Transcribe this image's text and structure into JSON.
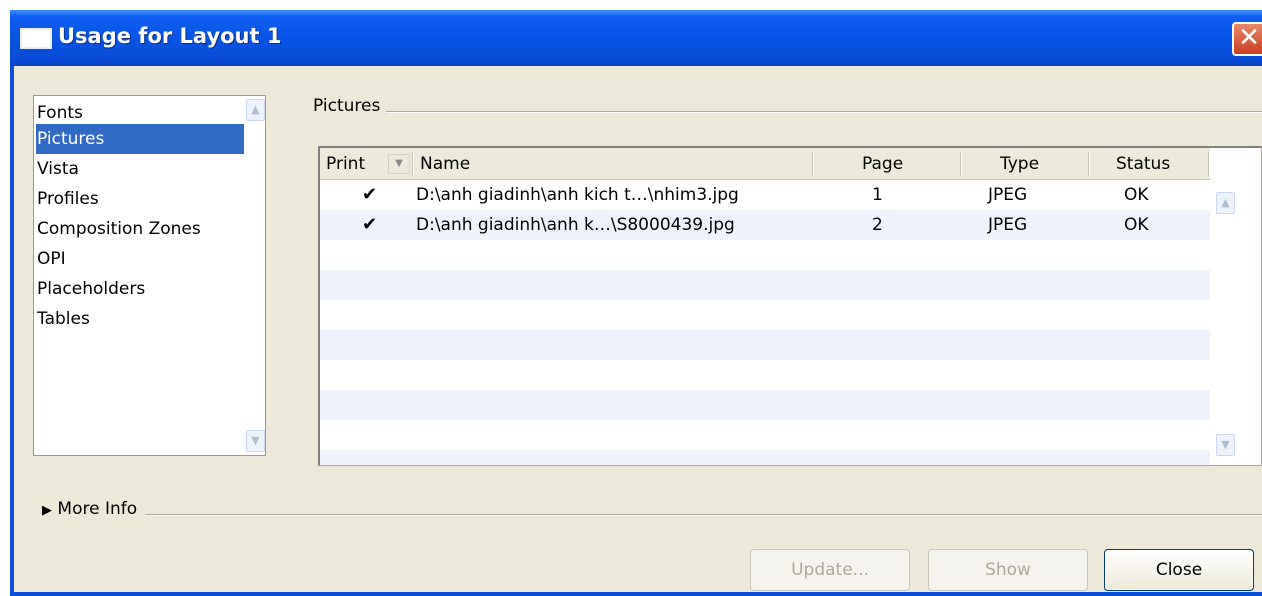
{
  "window": {
    "title": "Usage for Layout 1",
    "close_glyph": "✕"
  },
  "categories": [
    {
      "label": "Fonts",
      "selected": false
    },
    {
      "label": "Pictures",
      "selected": true
    },
    {
      "label": "Vista",
      "selected": false
    },
    {
      "label": "Profiles",
      "selected": false
    },
    {
      "label": "Composition Zones",
      "selected": false
    },
    {
      "label": "OPI",
      "selected": false
    },
    {
      "label": "Placeholders",
      "selected": false
    },
    {
      "label": "Tables",
      "selected": false
    }
  ],
  "pictures_group": {
    "label": "Pictures",
    "columns": [
      "Print",
      "Name",
      "Page",
      "Type",
      "Status"
    ],
    "rows": [
      {
        "print": "✔",
        "name": "D:\\anh giadinh\\anh kich t…\\nhim3.jpg",
        "page": "1",
        "type": "JPEG",
        "status": "OK"
      },
      {
        "print": "✔",
        "name": "D:\\anh giadinh\\anh k…\\S8000439.jpg",
        "page": "2",
        "type": "JPEG",
        "status": "OK"
      }
    ]
  },
  "more_info": {
    "label": "More Info",
    "arrow": "▶"
  },
  "buttons": {
    "update": "Update...",
    "show": "Show",
    "close": "Close"
  },
  "icons": {
    "scroll_up": "up-arrow-icon",
    "scroll_down": "down-arrow-icon",
    "dropdown": "chevron-down-icon"
  },
  "colors": {
    "titlebar": "#0754e6",
    "selection": "#316ac5",
    "dialog_bg": "#ece9d8",
    "alt_row": "#eef2fb"
  }
}
